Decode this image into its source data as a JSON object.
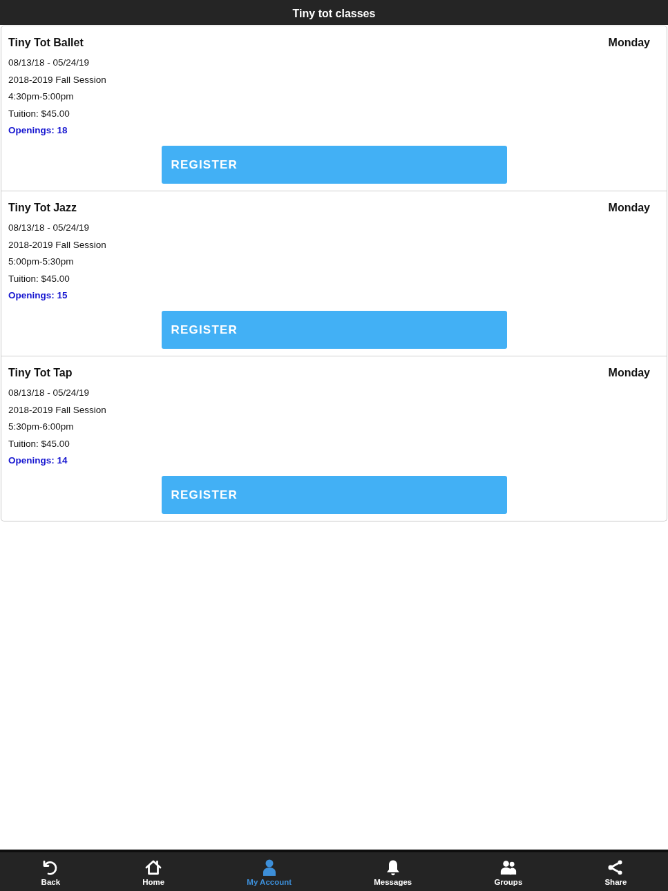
{
  "header": {
    "title": "Tiny tot classes"
  },
  "classes": [
    {
      "name": "Tiny Tot Ballet",
      "day": "Monday",
      "dates": "08/13/18 - 05/24/19",
      "session": "2018-2019 Fall Session",
      "time": "4:30pm-5:00pm",
      "tuition": "Tuition: $45.00",
      "openings": "Openings: 18",
      "button": "REGISTER"
    },
    {
      "name": "Tiny Tot Jazz",
      "day": "Monday",
      "dates": "08/13/18 - 05/24/19",
      "session": "2018-2019 Fall Session",
      "time": "5:00pm-5:30pm",
      "tuition": "Tuition: $45.00",
      "openings": "Openings: 15",
      "button": "REGISTER"
    },
    {
      "name": "Tiny Tot Tap",
      "day": "Monday",
      "dates": "08/13/18 - 05/24/19",
      "session": "2018-2019 Fall Session",
      "time": "5:30pm-6:00pm",
      "tuition": "Tuition: $45.00",
      "openings": "Openings: 14",
      "button": "REGISTER"
    }
  ],
  "tab_bar": {
    "items": [
      {
        "kind": "back",
        "label": "Back",
        "selected": false
      },
      {
        "kind": "home",
        "label": "Home",
        "selected": false
      },
      {
        "kind": "account",
        "label": "My Account",
        "selected": true
      },
      {
        "kind": "messages",
        "label": "Messages",
        "selected": false
      },
      {
        "kind": "groups",
        "label": "Groups",
        "selected": false
      },
      {
        "kind": "share",
        "label": "Share",
        "selected": false
      }
    ]
  }
}
